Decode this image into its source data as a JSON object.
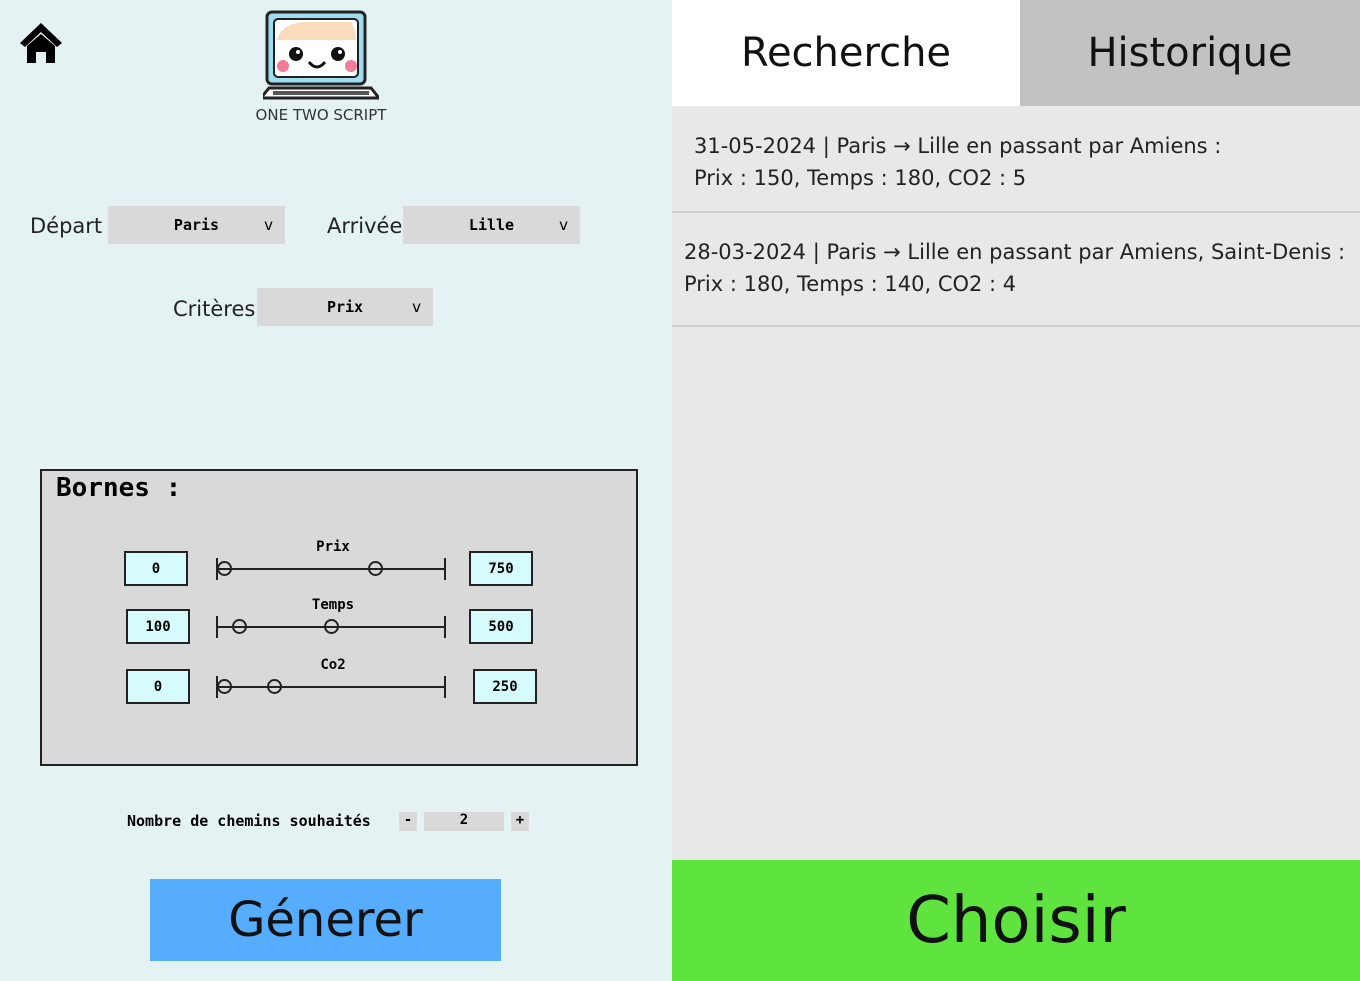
{
  "header": {
    "logo_text": "ONE TWO SCRIPT"
  },
  "form": {
    "depart_label": "Départ",
    "depart_value": "Paris",
    "arrivee_label": "Arrivée",
    "arrivee_value": "Lille",
    "criteres_label": "Critères",
    "criteres_value": "Prix",
    "chevron": "v"
  },
  "bornes": {
    "title": "Bornes :",
    "rows": [
      {
        "label": "Prix",
        "min": "0",
        "max": "750",
        "handles": [
          0.035,
          0.69
        ]
      },
      {
        "label": "Temps",
        "min": "100",
        "max": "500",
        "handles": [
          0.1,
          0.5
        ]
      },
      {
        "label": "Co2",
        "min": "0",
        "max": "250",
        "handles": [
          0.035,
          0.25
        ]
      }
    ]
  },
  "counter": {
    "label": "Nombre de chemins souhaités",
    "minus": "-",
    "value": "2",
    "plus": "+"
  },
  "generate_label": "Génerer",
  "tabs": {
    "search": "Recherche",
    "history": "Historique"
  },
  "history": [
    {
      "line1": "31-05-2024 | Paris → Lille en passant par Amiens :",
      "line2": "Prix : 150, Temps : 180, CO2 : 5"
    },
    {
      "line1": "28-03-2024 | Paris → Lille en passant par Amiens, Saint-Denis :",
      "line2": "Prix : 180, Temps : 140, CO2 : 4"
    }
  ],
  "choose_label": "Choisir",
  "colors": {
    "generate": "#56adfd",
    "choose": "#5fe33f",
    "box": "#d6fbfd"
  }
}
